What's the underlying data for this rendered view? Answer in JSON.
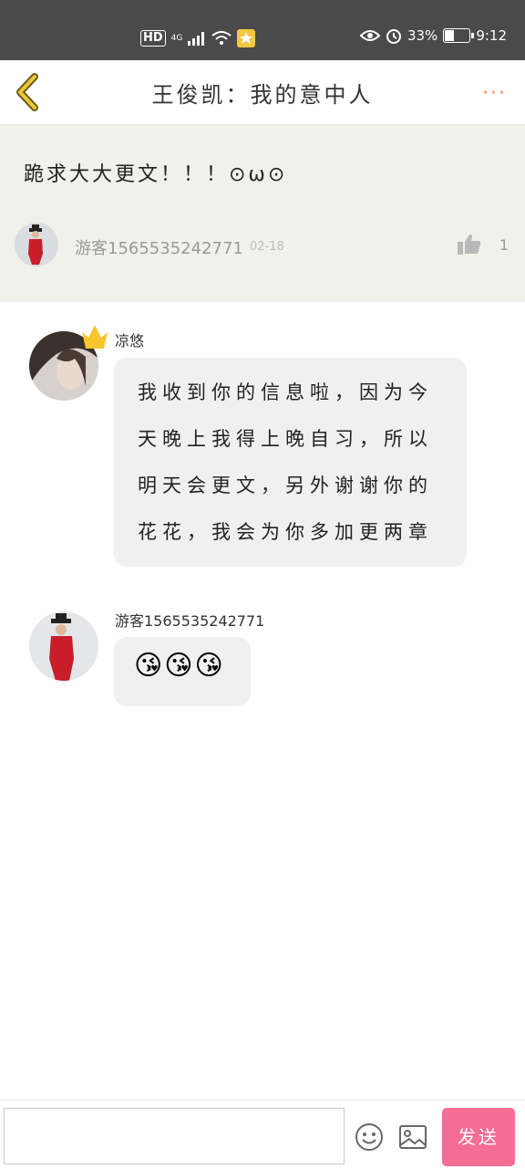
{
  "status": {
    "hd": "HD",
    "network": "4G",
    "battery_pct_text": "33%",
    "battery_level": 0.33,
    "time": "9:12"
  },
  "nav": {
    "back_icon": "chevron-left",
    "title": "王俊凯：我的意中人",
    "more": "···"
  },
  "post": {
    "text": "跪求大大更文！！！⊙ω⊙",
    "author": "游客1565535242771",
    "date": "02-18",
    "likes": "1"
  },
  "messages": [
    {
      "author": "凉悠",
      "text": "我收到你的信息啦，因为今天晚上我得上晚自习，所以明天会更文，另外谢谢你的花花，我会为你多加更两章"
    },
    {
      "author": "游客1565535242771",
      "text": "😘😘😘"
    }
  ],
  "composer": {
    "input_value": "",
    "emoji_icon": "smiley-icon",
    "image_icon": "image-icon",
    "send_label": "发送"
  },
  "colors": {
    "status_bar": "#4a4a4a",
    "accent_more": "#f08a50",
    "back_chevron": "#e8c93a",
    "send_button": "#f56c95",
    "post_bg": "#f1f1ec",
    "bubble_bg": "#f0f0f0"
  }
}
